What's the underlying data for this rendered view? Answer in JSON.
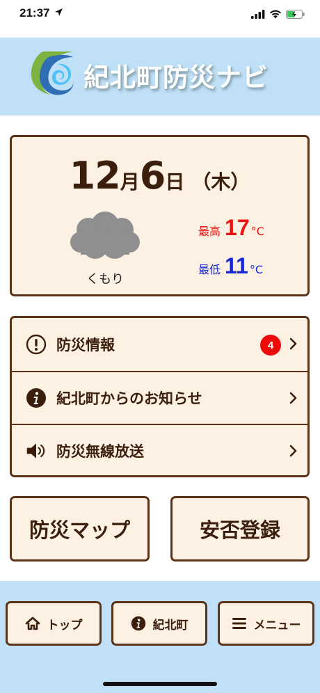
{
  "status_bar": {
    "time": "21:37"
  },
  "header": {
    "title": "紀北町防災ナビ"
  },
  "weather": {
    "month": "12",
    "month_unit": "月",
    "day": "6",
    "day_unit": "日",
    "weekday": "（木）",
    "condition": "くもり",
    "high_label": "最高",
    "high_value": "17",
    "low_label": "最低",
    "low_value": "11",
    "temp_unit": "°C",
    "colors": {
      "high": "#ee1111",
      "low": "#1525d8"
    }
  },
  "menu": {
    "items": [
      {
        "label": "防災情報",
        "icon": "exclamation-circle-icon",
        "badge": "4"
      },
      {
        "label": "紀北町からのお知らせ",
        "icon": "info-circle-icon"
      },
      {
        "label": "防災無線放送",
        "icon": "speaker-icon"
      }
    ]
  },
  "buttons": {
    "map": "防災マップ",
    "safety": "安否登録"
  },
  "footer_nav": {
    "top": "トップ",
    "town": "紀北町",
    "menu": "メニュー"
  },
  "colors": {
    "accent_brown": "#5c3318",
    "panel_bg": "#fdf1e4",
    "header_bg": "#bfe0f7",
    "badge_red": "#ee0a0a"
  }
}
